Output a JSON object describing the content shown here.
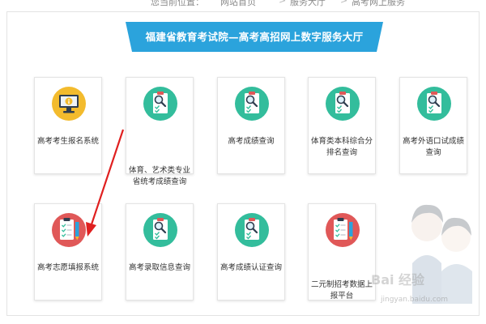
{
  "breadcrumb": {
    "location_label": "您当前位置：",
    "items": [
      "网站首页",
      "服务大厅",
      "高考网上服务"
    ]
  },
  "banner": {
    "title": "福建省教育考试院—高考高招网上数字服务大厅"
  },
  "tiles": [
    {
      "label": "高考考生报名系统",
      "icon": "monitor-info-icon"
    },
    {
      "label": "体育、艺术类专业省统考成绩查询",
      "icon": "clipboard-search-icon"
    },
    {
      "label": "高考成绩查询",
      "icon": "clipboard-search-icon"
    },
    {
      "label": "体育类本科综合分排名查询",
      "icon": "clipboard-search-icon"
    },
    {
      "label": "高考外语口试成绩查询",
      "icon": "clipboard-search-icon"
    },
    {
      "label": "高考志愿填报系统",
      "icon": "clipboard-pen-icon"
    },
    {
      "label": "高考录取信息查询",
      "icon": "clipboard-search-icon"
    },
    {
      "label": "高考成绩认证查询",
      "icon": "clipboard-search-icon"
    },
    {
      "label": "二元制招考数据上报平台",
      "icon": "clipboard-pen-icon"
    }
  ],
  "watermark": {
    "text": "Bai 经验",
    "url": "jingyan.baidu.com"
  },
  "colors": {
    "banner_blue": "#2ba3dc",
    "teal": "#33bd9c",
    "yellow": "#f3bb2d",
    "red": "#e05858",
    "arrow_red": "#e02020"
  }
}
